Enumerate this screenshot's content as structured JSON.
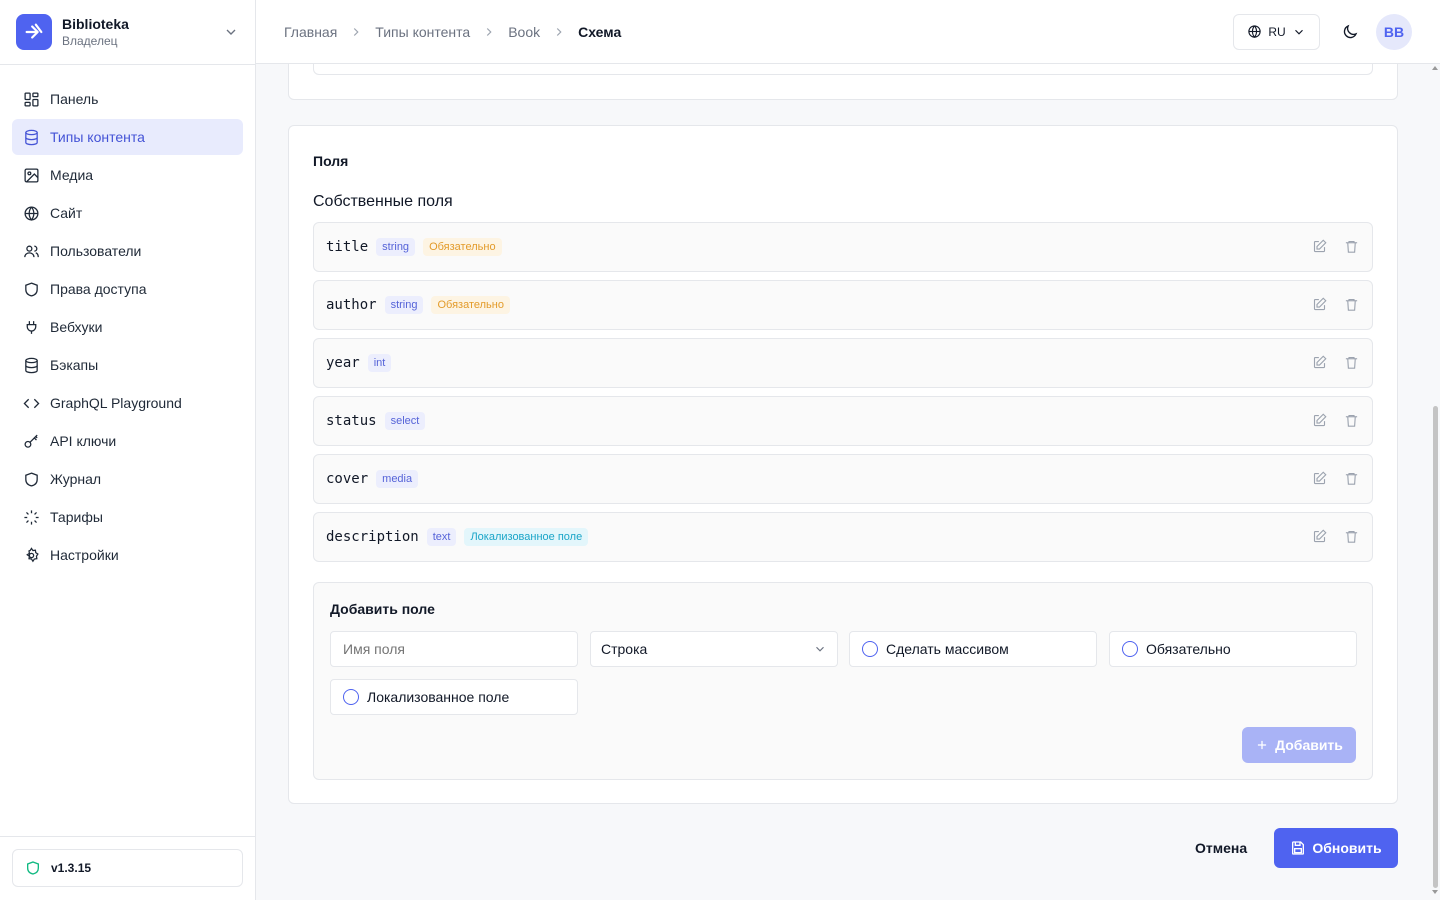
{
  "brand": {
    "name": "Biblioteka",
    "role": "Владелец"
  },
  "sidebar": {
    "items": [
      {
        "label": "Панель",
        "icon": "dashboard-icon"
      },
      {
        "label": "Типы контента",
        "icon": "database-icon",
        "active": true
      },
      {
        "label": "Медиа",
        "icon": "image-icon"
      },
      {
        "label": "Сайт",
        "icon": "globe-icon"
      },
      {
        "label": "Пользователи",
        "icon": "users-icon"
      },
      {
        "label": "Права доступа",
        "icon": "shield-icon"
      },
      {
        "label": "Вебхуки",
        "icon": "plug-icon"
      },
      {
        "label": "Бэкапы",
        "icon": "database-icon"
      },
      {
        "label": "GraphQL Playground",
        "icon": "code-icon"
      },
      {
        "label": "API ключи",
        "icon": "key-icon"
      },
      {
        "label": "Журнал",
        "icon": "shield-icon"
      },
      {
        "label": "Тарифы",
        "icon": "loader-icon"
      },
      {
        "label": "Настройки",
        "icon": "gear-icon"
      }
    ],
    "version": "v1.3.15"
  },
  "header": {
    "breadcrumbs": [
      "Главная",
      "Типы контента",
      "Book",
      "Схема"
    ],
    "lang": "RU",
    "avatar": "BB"
  },
  "fields_card": {
    "title": "Поля",
    "section_title": "Собственные поля",
    "fields": [
      {
        "name": "title",
        "type": "string",
        "badge": "Обязательно",
        "badge_kind": "req"
      },
      {
        "name": "author",
        "type": "string",
        "badge": "Обязательно",
        "badge_kind": "req"
      },
      {
        "name": "year",
        "type": "int",
        "badge": "",
        "badge_kind": ""
      },
      {
        "name": "status",
        "type": "select",
        "badge": "",
        "badge_kind": ""
      },
      {
        "name": "cover",
        "type": "media",
        "badge": "",
        "badge_kind": ""
      },
      {
        "name": "description",
        "type": "text",
        "badge": "Локализованное поле",
        "badge_kind": "loc"
      }
    ]
  },
  "add_field": {
    "title": "Добавить поле",
    "name_placeholder": "Имя поля",
    "type_value": "Строка",
    "array_label": "Сделать массивом",
    "required_label": "Обязательно",
    "localized_label": "Локализованное поле",
    "add_label": "Добавить"
  },
  "actions": {
    "cancel": "Отмена",
    "update": "Обновить"
  },
  "colors": {
    "accent": "#4f63f0",
    "accent_disabled": "#a9b3f6",
    "active_bg": "#e8ebfd"
  }
}
